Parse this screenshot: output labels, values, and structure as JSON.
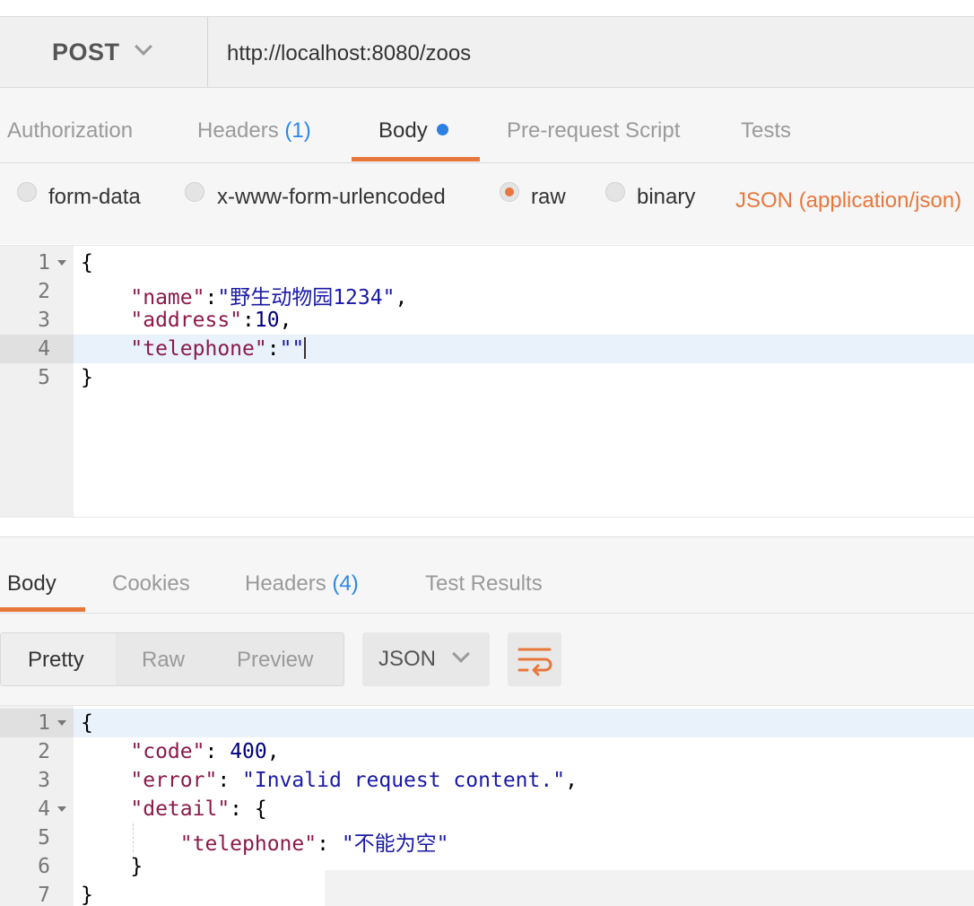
{
  "request": {
    "method": "POST",
    "url": "http://localhost:8080/zoos",
    "tabs": [
      {
        "label": "Authorization",
        "count": ""
      },
      {
        "label": "Headers",
        "count": "(1)"
      },
      {
        "label": "Body",
        "count": ""
      },
      {
        "label": "Pre-request Script",
        "count": ""
      },
      {
        "label": "Tests",
        "count": ""
      }
    ],
    "active_tab": "Body",
    "body_types": [
      "form-data",
      "x-www-form-urlencoded",
      "raw",
      "binary"
    ],
    "selected_body_type": "raw",
    "content_type": "JSON (application/json)",
    "editor_lines": [
      {
        "num": "1",
        "text": "{"
      },
      {
        "num": "2",
        "key": "\"name\"",
        "sep": ":",
        "value": "\"野生动物园1234\"",
        "end": ","
      },
      {
        "num": "3",
        "key": "\"address\"",
        "sep": ":",
        "value": "10",
        "end": ","
      },
      {
        "num": "4",
        "key": "\"telephone\"",
        "sep": ":",
        "value": "\"\"",
        "end": ""
      },
      {
        "num": "5",
        "text": "}"
      }
    ]
  },
  "response": {
    "tabs": [
      {
        "label": "Body",
        "count": ""
      },
      {
        "label": "Cookies",
        "count": ""
      },
      {
        "label": "Headers",
        "count": "(4)"
      },
      {
        "label": "Test Results",
        "count": ""
      }
    ],
    "active_tab": "Body",
    "view_modes": [
      "Pretty",
      "Raw",
      "Preview"
    ],
    "active_view": "Pretty",
    "format": "JSON",
    "body_lines": [
      {
        "num": "1",
        "text": "{"
      },
      {
        "num": "2",
        "key": "\"code\"",
        "sep": ": ",
        "value": "400",
        "end": ","
      },
      {
        "num": "3",
        "key": "\"error\"",
        "sep": ": ",
        "value": "\"Invalid request content.\"",
        "end": ","
      },
      {
        "num": "4",
        "key": "\"detail\"",
        "sep": ": ",
        "value": "{",
        "end": ""
      },
      {
        "num": "5",
        "key": "\"telephone\"",
        "sep": ": ",
        "value": "\"不能为空\"",
        "end": ""
      },
      {
        "num": "6",
        "text": "}"
      },
      {
        "num": "7",
        "text": "}"
      }
    ]
  },
  "colors": {
    "accent": "#e8773c",
    "count_blue": "#2d86e8",
    "json_key": "#8a1a4b",
    "json_string": "#1a1aa6"
  }
}
